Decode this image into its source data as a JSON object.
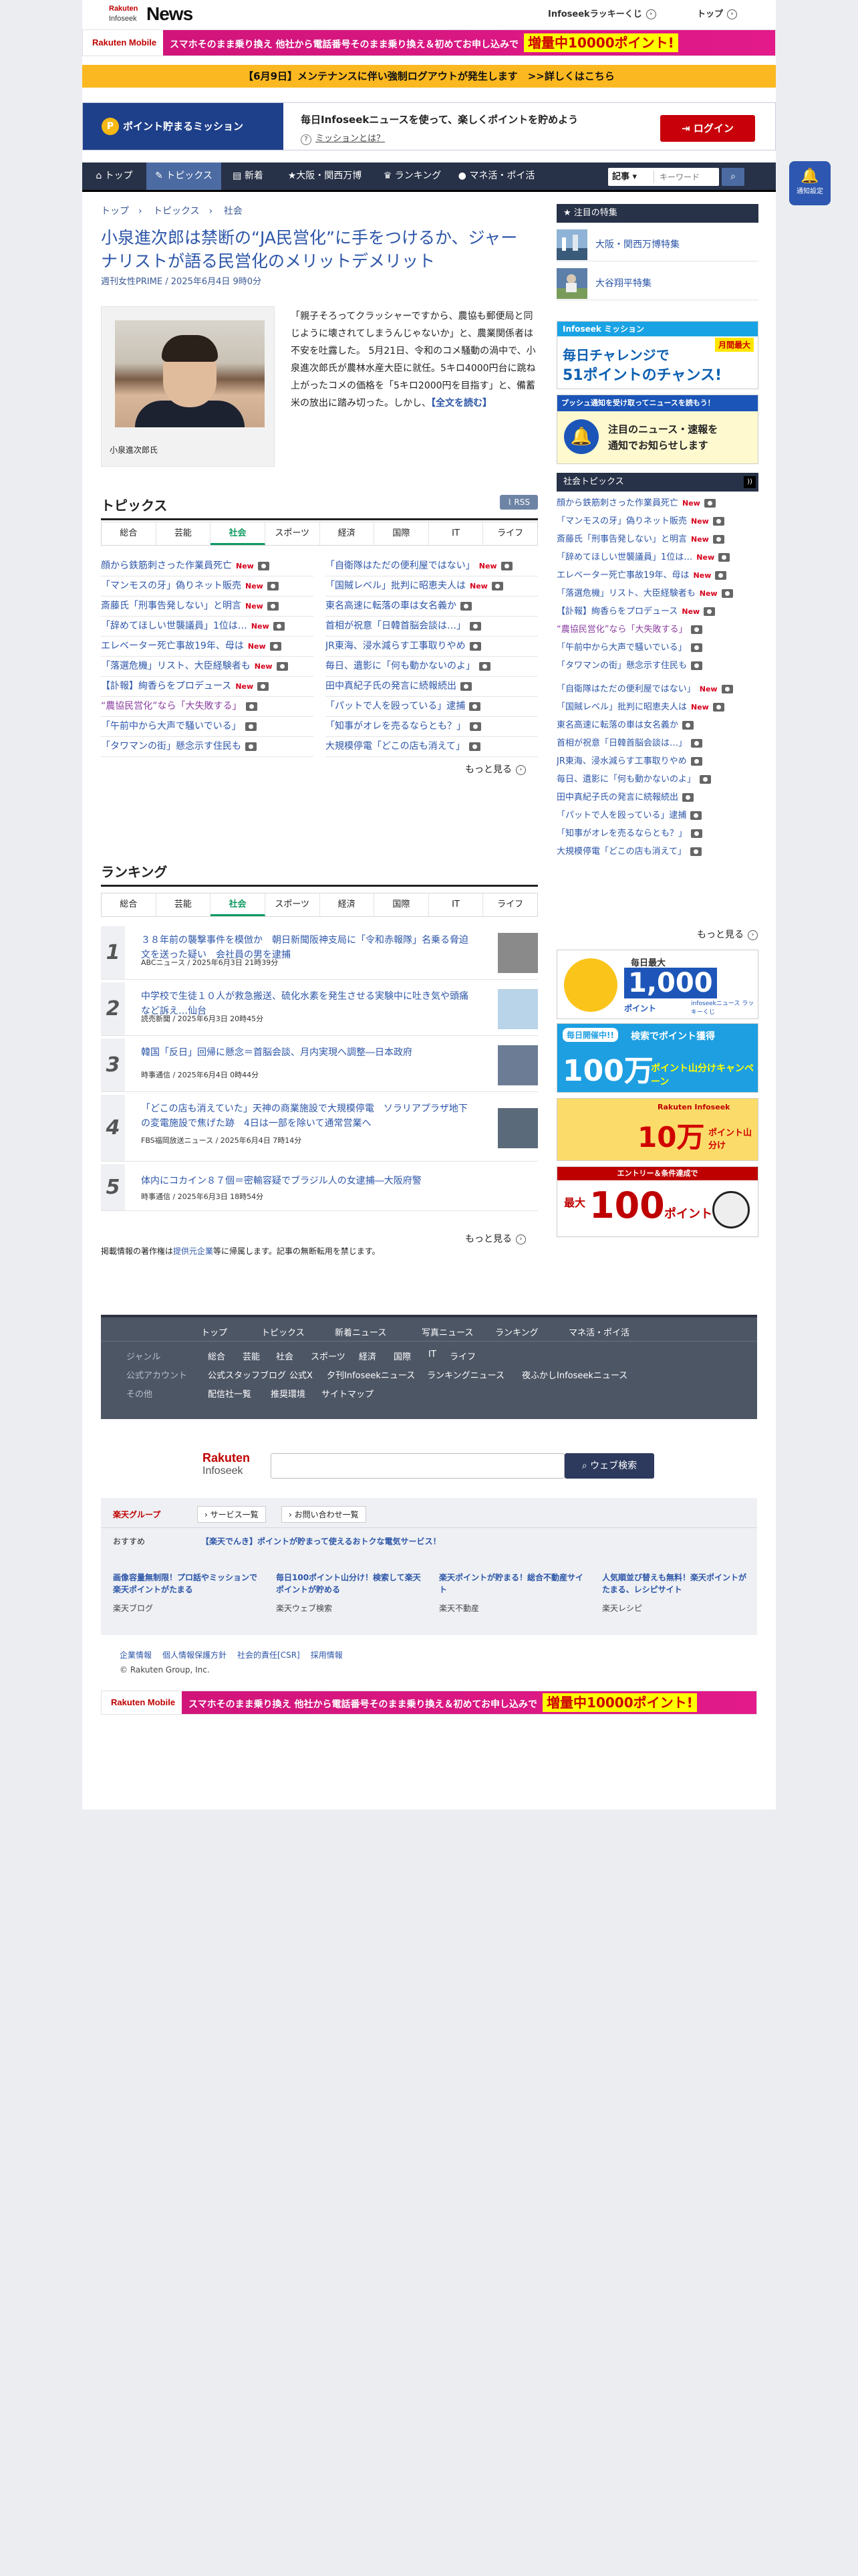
{
  "header": {
    "logo_top": "Rakuten",
    "logo_mid": "Infoseek",
    "logo_main": "News",
    "lucky": "Infoseekラッキーくじ",
    "top": "トップ"
  },
  "promo": {
    "brand": "Rakuten Mobile",
    "text": "スマホそのまま乗り換え 他社から電話番号そのまま乗り換え＆初めてお申し込みで",
    "badge": "増量中10000ポイント!"
  },
  "notice": "【6月9日】メンテナンスに伴い強制ログアウトが発生します　>>詳しくはこちら",
  "mission": {
    "label": "ポイント貯まるミッション",
    "title": "毎日Infoseekニュースを使って、楽しくポイントを貯めよう",
    "sub": "ミッションとは？",
    "login": "ログイン"
  },
  "nav": {
    "items": [
      "トップ",
      "トピックス",
      "新着",
      "大阪・関西万博",
      "ランキング",
      "マネ活・ポイ活"
    ],
    "search_cat": "記事",
    "search_placeholder": "キーワード",
    "notify": "通知設定"
  },
  "breadcrumb": [
    "トップ",
    "トピックス",
    "社会"
  ],
  "article": {
    "title": "小泉進次郎は禁断の“JA民営化”に手をつけるか、ジャーナリストが語る民営化のメリットデメリット",
    "source": "週刊女性PRIME / 2025年6月4日 9時0分",
    "caption": "小泉進次郎氏",
    "lead": "「親子そろってクラッシャーですから、農協も郵便局と同じように壊されてしまうんじゃないか」と、農業関係者は不安を吐露した。 5月21日、令和のコメ騒動の渦中で、小泉進次郎氏が農林水産大臣に就任。5キロ4000円台に跳ね上がったコメの価格を「5キロ2000円を目指す」と、備蓄米の放出に踏み切った。しかし、",
    "more": "【全文を読む】"
  },
  "topics": {
    "heading": "トピックス",
    "rss": "RSS",
    "tabs": [
      "総合",
      "芸能",
      "社会",
      "スポーツ",
      "経済",
      "国際",
      "IT",
      "ライフ"
    ],
    "left": [
      {
        "t": "顔から鉄筋刺さった作業員死亡",
        "new": "New"
      },
      {
        "t": "「マンモスの牙」偽りネット販売",
        "new": "New"
      },
      {
        "t": "斎藤氏「刑事告発しない」と明言",
        "new": "New"
      },
      {
        "t": "「辞めてほしい世襲議員」1位は…",
        "new": "New"
      },
      {
        "t": "エレベーター死亡事故19年、母は",
        "new": "New"
      },
      {
        "t": "「落選危機」リスト、大臣経験者も",
        "new": "New"
      },
      {
        "t": "【訃報】絢香らをプロデュース",
        "new": "New"
      },
      {
        "t": "“農協民営化”なら「大失敗する」",
        "new": ""
      },
      {
        "t": "「午前中から大声で騒いでいる」",
        "new": ""
      },
      {
        "t": "「タワマンの街」懸念示す住民も",
        "new": ""
      }
    ],
    "right": [
      {
        "t": "「自衛隊はただの便利屋ではない」",
        "new": "New"
      },
      {
        "t": "「国賊レベル」批判に昭恵夫人は",
        "new": "New"
      },
      {
        "t": "東名高速に転落の車は女名義か",
        "new": ""
      },
      {
        "t": "首相が祝意「日韓首脳会談は…」",
        "new": ""
      },
      {
        "t": "JR東海、浸水減らす工事取りやめ",
        "new": ""
      },
      {
        "t": "毎日、遺影に「何も動かないのよ」",
        "new": ""
      },
      {
        "t": "田中真紀子氏の発言に続報続出",
        "new": ""
      },
      {
        "t": "「パットで人を殴っている」逮捕",
        "new": ""
      },
      {
        "t": "「知事がオレを売るならとも？」",
        "new": ""
      },
      {
        "t": "大規模停電「どこの店も消えて」",
        "new": ""
      }
    ],
    "more": "もっと見る"
  },
  "ranking": {
    "heading": "ランキング",
    "tabs": [
      "総合",
      "芸能",
      "社会",
      "スポーツ",
      "経済",
      "国際",
      "IT",
      "ライフ"
    ],
    "items": [
      {
        "n": "1",
        "t": "３８年前の襲撃事件を模倣か　朝日新聞阪神支局に「令和赤報隊」名乗る脅迫文を送った疑い　会社員の男を逮捕",
        "m": "ABCニュース / 2025年6月3日 21時39分"
      },
      {
        "n": "2",
        "t": "中学校で生徒１０人が救急搬送、硫化水素を発生させる実験中に吐き気や頭痛など訴え…仙台",
        "m": "読売新聞 / 2025年6月3日 20時45分"
      },
      {
        "n": "3",
        "t": "韓国「反日」回帰に懸念＝首脳会談、月内実現へ調整―日本政府",
        "m": "時事通信 / 2025年6月4日 0時44分"
      },
      {
        "n": "4",
        "t": "「どこの店も消えていた」天神の商業施設で大規模停電　ソラリアプラザ地下の変電施設で焦げた跡　4日は一部を除いて通常営業へ",
        "m": "FBS福岡放送ニュース / 2025年6月4日 7時14分"
      },
      {
        "n": "5",
        "t": "体内にコカイン８７個＝密輸容疑でブラジル人の女逮捕―大阪府警",
        "m": "時事通信 / 2025年6月3日 18時54分"
      }
    ],
    "more": "もっと見る"
  },
  "credit": {
    "a": "掲載情報の著作権は",
    "b": "提供元企業",
    "c": "等に帰属します。記事の無断転用を禁じます。"
  },
  "footnav": {
    "top": [
      "トップ",
      "トピックス",
      "新着ニュース",
      "写真ニュース",
      "ランキング",
      "マネ活・ポイ活"
    ],
    "genre_label": "ジャンル",
    "genres": [
      "総合",
      "芸能",
      "社会",
      "スポーツ",
      "経済",
      "国際",
      "IT",
      "ライフ"
    ],
    "official_label": "公式アカウント",
    "officials": [
      "公式スタッフブログ",
      "公式X",
      "夕刊Infoseekニュース",
      "ランキングニュース",
      "夜ふかしInfoseekニュース"
    ],
    "other_label": "その他",
    "others": [
      "配信社一覧",
      "推奨環境",
      "サイトマップ"
    ]
  },
  "rsearch": {
    "r": "Rakuten",
    "i": "Infoseek",
    "btn": "ウェブ検索"
  },
  "rgroup": {
    "label": "楽天グループ",
    "b1": "サービス一覧",
    "b2": "お問い合わせ一覧",
    "rec_label": "おすすめ",
    "rec": "【楽天でんき】ポイントが貯まって使えるおトクな電気サービス！",
    "cards": [
      {
        "t": "画像容量無制限！プロ話やミッションで楽天ポイントがたまる",
        "s": "楽天ブログ"
      },
      {
        "t": "毎日100ポイント山分け！検索して楽天ポイントが貯める",
        "s": "楽天ウェブ検索"
      },
      {
        "t": "楽天ポイントが貯まる！総合不動産サイト",
        "s": "楽天不動産"
      },
      {
        "t": "人気順並び替えも無料！楽天ポイントがたまる、レシピサイト",
        "s": "楽天レシピ"
      }
    ]
  },
  "corp": [
    "企業情報",
    "個人情報保護方針",
    "社会的責任[CSR]",
    "採用情報"
  ],
  "copyright": "© Rakuten Group, Inc.",
  "sidebar": {
    "featured_head": "★ 注目の特集",
    "featured": [
      "大阪・関西万博特集",
      "大谷翔平特集"
    ],
    "banner1": {
      "top": "Infoseek ミッション",
      "mid": "毎日チャレンジで",
      "big": "51ポイントのチャンス!",
      "tag": "月間最大"
    },
    "banner2": {
      "top": "プッシュ通知を受け取ってニュースを読もう！",
      "mid": "注目のニュース・速報を",
      "low": "通知でお知らせします"
    },
    "social_head": "社会トピックス",
    "social": [
      {
        "t": "顔から鉄筋刺さった作業員死亡",
        "new": "New"
      },
      {
        "t": "「マンモスの牙」偽りネット販売",
        "new": "New"
      },
      {
        "t": "斎藤氏「刑事告発しない」と明言",
        "new": "New"
      },
      {
        "t": "「辞めてほしい世襲議員」1位は…",
        "new": "New"
      },
      {
        "t": "エレベーター死亡事故19年、母は",
        "new": "New"
      },
      {
        "t": "「落選危機」リスト、大臣経験者も",
        "new": "New"
      },
      {
        "t": "【訃報】絢香らをプロデュース",
        "new": "New"
      },
      {
        "t": "“農協民営化”なら「大失敗する」",
        "new": ""
      },
      {
        "t": "「午前中から大声で騒いでいる」",
        "new": ""
      },
      {
        "t": "「タワマンの街」懸念示す住民も",
        "new": ""
      },
      {
        "t": "「自衛隊はただの便利屋ではない」",
        "new": "New"
      },
      {
        "t": "「国賊レベル」批判に昭恵夫人は",
        "new": "New"
      },
      {
        "t": "東名高速に転落の車は女名義か",
        "new": ""
      },
      {
        "t": "首相が祝意「日韓首脳会談は…」",
        "new": ""
      },
      {
        "t": "JR東海、浸水減らす工事取りやめ",
        "new": ""
      },
      {
        "t": "毎日、遺影に「何も動かないのよ」",
        "new": ""
      },
      {
        "t": "田中真紀子氏の発言に続報続出",
        "new": ""
      },
      {
        "t": "「パットで人を殴っている」逮捕",
        "new": ""
      },
      {
        "t": "「知事がオレを売るならとも？」",
        "new": ""
      },
      {
        "t": "大規模停電「どこの店も消えて」",
        "new": ""
      }
    ],
    "more": "もっと見る",
    "ad1": {
      "a": "毎日最大",
      "b": "1,000",
      "c": "ポイント",
      "d": "infoseekニュース ラッキーくじ"
    },
    "ad2": {
      "a": "毎日開催中!!",
      "b": "検索でポイント獲得",
      "c": "100万",
      "d": "ポイント山分けキャンペーン"
    },
    "ad3": {
      "a": "Rakuten Infoseek",
      "b": "10万",
      "c": "ポイント山分け"
    },
    "ad4": {
      "a": "エントリー＆条件達成で",
      "b": "最大",
      "c": "100",
      "d": "ポイント"
    }
  }
}
